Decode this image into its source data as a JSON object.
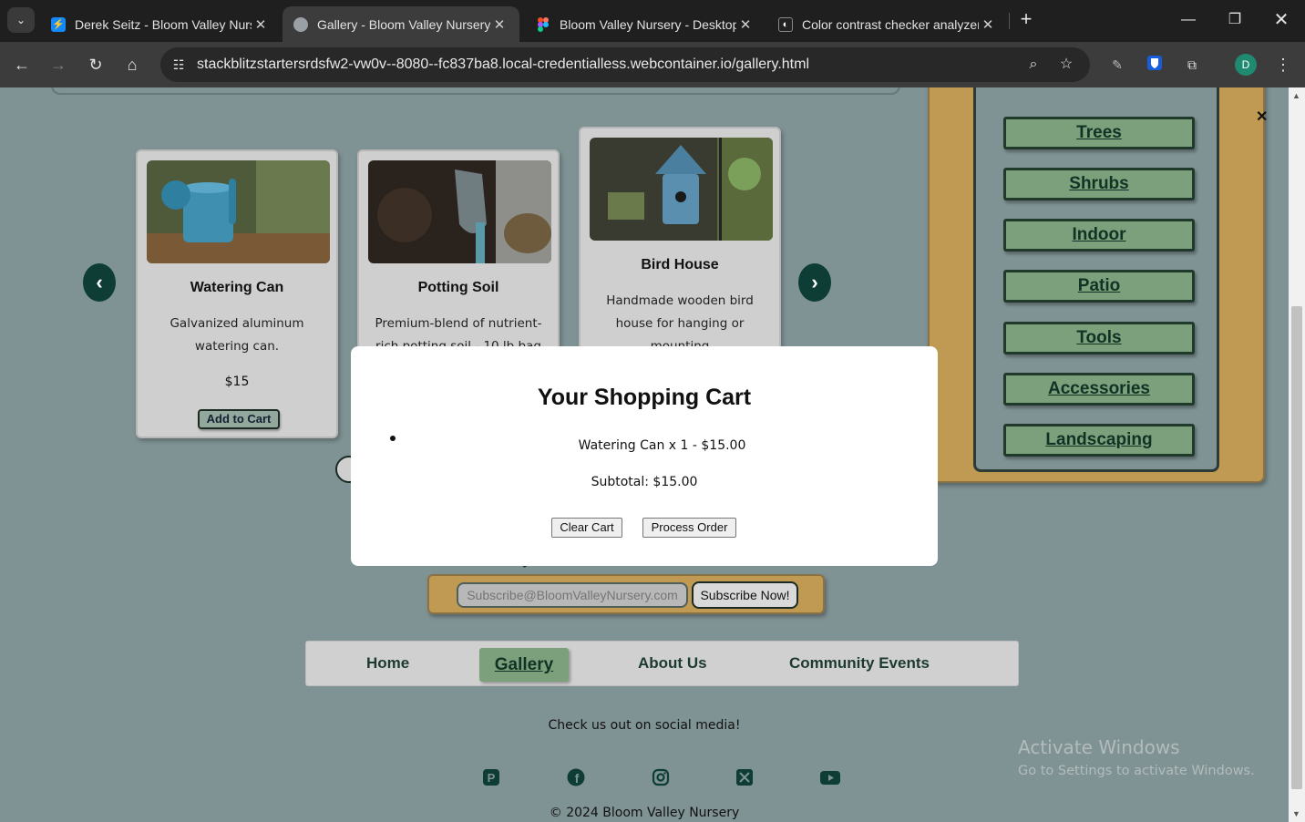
{
  "browser": {
    "tabs": [
      {
        "title": "Derek Seitz - Bloom Valley Nurs",
        "icon": "stackblitz-icon",
        "icon_color": "#1389fd"
      },
      {
        "title": "Gallery - Bloom Valley Nursery",
        "icon": "globe-icon",
        "icon_color": "#9aa0a6"
      },
      {
        "title": "Bloom Valley Nursery - Desktop",
        "icon": "figma-icon",
        "icon_color": "#f24e1e"
      },
      {
        "title": "Color contrast checker analyzer",
        "icon": "contrast-checker-icon",
        "icon_color": "#222222"
      }
    ],
    "url": "stackblitzstartersrdsfw2-vw0v--8080--fc837ba8.local-credentialless.webcontainer.io/gallery.html",
    "profile_initial": "D"
  },
  "products": [
    {
      "name": "Watering Can",
      "description": "Galvanized aluminum watering can.",
      "price": "$15",
      "button": "Add to Cart"
    },
    {
      "name": "Potting Soil",
      "description": "Premium-blend of nutrient-rich potting soil - 10 lb bag",
      "price": "",
      "button": ""
    },
    {
      "name": "Bird House",
      "description": "Handmade wooden bird house for hanging or mounting",
      "price": "",
      "button": ""
    }
  ],
  "categories": [
    "Trees",
    "Shrubs",
    "Indoor",
    "Patio",
    "Tools",
    "Accessories",
    "Landscaping"
  ],
  "newsletter": {
    "heading": "Enter your email to subscribe to our newsletter",
    "email_placeholder": "Subscribe@BloomValleyNursery.com",
    "button": "Subscribe Now!"
  },
  "footer_nav": {
    "home": "Home",
    "gallery": "Gallery",
    "about": "About Us",
    "events": "Community Events"
  },
  "social": {
    "text": "Check us out on social media!",
    "icons": [
      "pinterest-icon",
      "facebook-icon",
      "instagram-icon",
      "x-icon",
      "youtube-icon"
    ]
  },
  "copyright": "© 2024 Bloom Valley Nursery",
  "cart": {
    "title": "Your Shopping Cart",
    "item": "Watering Can x 1 - $15.00",
    "subtotal": "Subtotal: $15.00",
    "clear_button": "Clear Cart",
    "process_button": "Process Order"
  },
  "watermark": {
    "line1": "Activate Windows",
    "line2": "Go to Settings to activate Windows."
  },
  "colors": {
    "accent_green": "#0d3d34",
    "gold": "#c09a52",
    "page_bg": "#7f9294"
  }
}
